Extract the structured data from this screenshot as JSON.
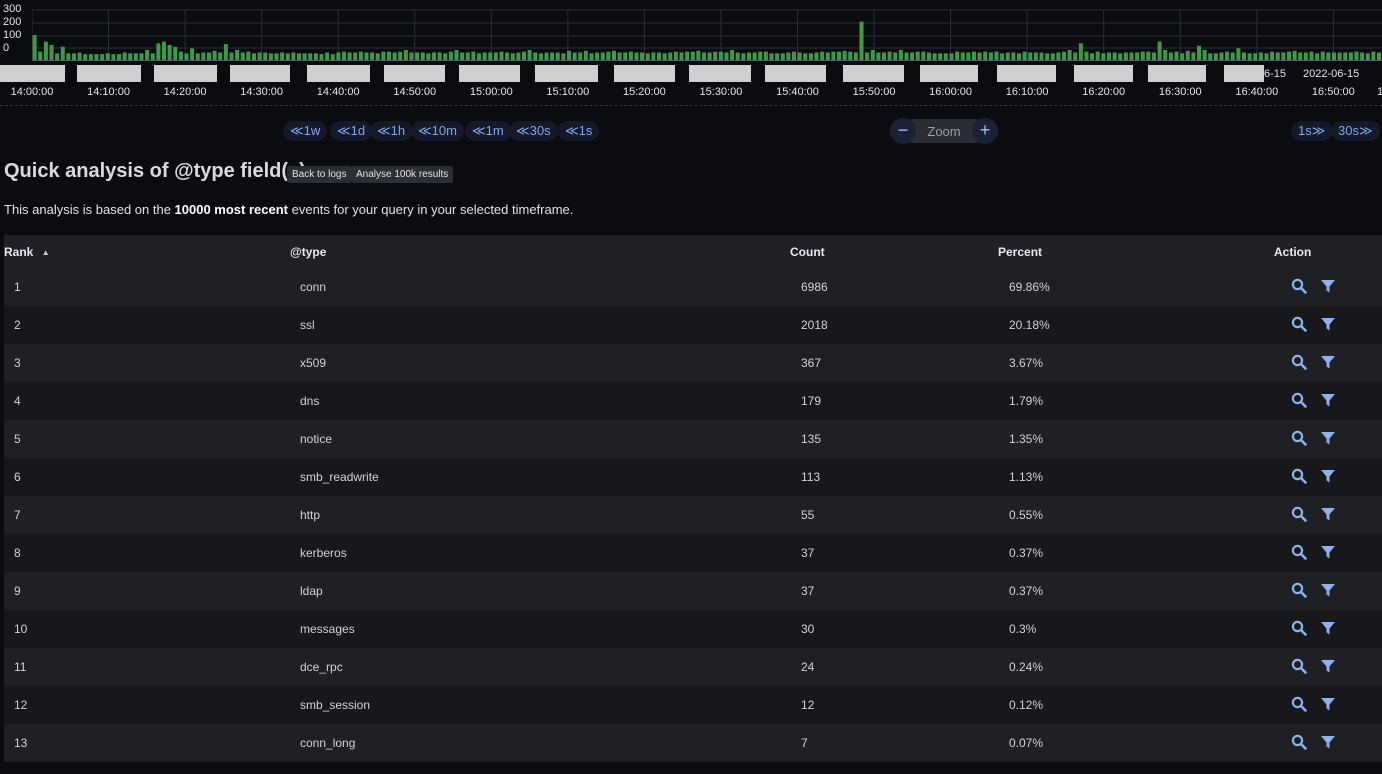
{
  "histogram": {
    "y_ticks": [
      "300",
      "200",
      "100",
      "0"
    ],
    "y_max": 300,
    "bar_values": [
      150,
      50,
      110,
      90,
      40,
      80,
      40,
      40,
      45,
      35,
      35,
      35,
      35,
      40,
      35,
      35,
      45,
      40,
      40,
      40,
      60,
      40,
      100,
      110,
      90,
      80,
      50,
      40,
      70,
      40,
      45,
      45,
      55,
      45,
      95,
      45,
      60,
      45,
      50,
      40,
      45,
      45,
      40,
      40,
      45,
      40,
      45,
      40,
      40,
      40,
      40,
      35,
      45,
      35,
      45,
      50,
      45,
      45,
      50,
      45,
      45,
      40,
      50,
      50,
      45,
      50,
      60,
      45,
      45,
      45,
      40,
      45,
      45,
      40,
      50,
      60,
      45,
      45,
      50,
      40,
      45,
      45,
      45,
      50,
      45,
      40,
      45,
      50,
      60,
      45,
      40,
      45,
      45,
      45,
      40,
      55,
      45,
      45,
      55,
      40,
      45,
      45,
      50,
      55,
      45,
      45,
      50,
      45,
      45,
      40,
      45,
      45,
      40,
      45,
      50,
      45,
      50,
      50,
      55,
      45,
      45,
      50,
      50,
      45,
      60,
      45,
      40,
      45,
      45,
      50,
      50,
      40,
      40,
      40,
      45,
      50,
      45,
      40,
      40,
      45,
      50,
      45,
      50,
      50,
      55,
      50,
      45,
      55,
      45,
      60,
      45,
      45,
      50,
      45,
      60,
      45,
      45,
      50,
      50,
      45,
      40,
      40,
      40,
      40,
      50,
      45,
      45,
      50,
      45,
      50,
      45,
      50,
      40,
      45,
      45,
      40,
      50,
      45,
      45,
      45,
      40,
      40,
      45,
      50,
      60,
      45,
      100,
      50,
      40,
      50,
      40,
      45,
      45,
      40,
      45,
      45,
      45,
      50,
      50,
      45,
      110,
      60,
      45,
      50,
      40,
      55,
      45,
      85,
      60,
      40,
      40,
      45,
      50,
      45,
      70,
      45,
      40,
      40,
      45,
      40,
      50,
      45,
      45,
      50,
      55,
      45,
      45,
      50,
      40,
      50,
      45,
      45,
      45,
      45,
      45,
      50,
      45,
      40,
      50,
      45,
      40,
      45,
      60,
      40,
      45,
      45,
      55,
      45,
      40,
      55,
      45,
      45,
      40,
      45,
      40,
      45,
      45,
      60,
      45,
      40,
      50,
      45,
      45,
      40,
      50,
      45,
      45,
      40,
      40,
      45,
      45,
      40,
      45,
      110,
      60,
      50,
      40,
      55,
      45,
      40,
      55,
      45,
      45,
      40,
      45,
      40,
      45,
      45,
      60,
      45,
      40,
      50,
      45,
      45,
      40,
      50,
      45,
      45,
      40,
      40,
      45,
      45,
      40,
      45,
      45,
      45,
      40,
      45,
      40,
      50,
      45,
      45,
      50,
      55,
      45,
      45,
      50,
      40,
      50,
      45,
      45,
      45,
      45,
      45,
      50,
      45,
      40,
      50,
      45,
      40,
      45,
      60,
      45,
      50,
      45,
      40,
      45,
      45,
      40,
      45
    ],
    "spike_value": 230,
    "date_label": "2022-06-15",
    "date_label_partial": "6-15",
    "x_ticks": [
      "14:00:00",
      "14:10:00",
      "14:20:00",
      "14:30:00",
      "14:40:00",
      "14:50:00",
      "15:00:00",
      "15:10:00",
      "15:20:00",
      "15:30:00",
      "15:40:00",
      "15:50:00",
      "16:00:00",
      "16:10:00",
      "16:20:00",
      "16:30:00",
      "16:40:00",
      "16:50:00"
    ],
    "bar_color": "#3d9a47"
  },
  "nav": {
    "back_buttons": [
      "≪1w",
      "≪1d",
      "≪1h",
      "≪10m",
      "≪1m",
      "≪30s",
      "≪1s"
    ],
    "zoom_label": "Zoom",
    "zoom_out": "−",
    "zoom_in": "+",
    "forward_buttons": [
      "1s≫",
      "30s≫"
    ]
  },
  "header": {
    "title": "Quick analysis of @type field(s)",
    "back_to_logs": "Back to logs",
    "analyse_100k": "Analyse 100k results"
  },
  "description": {
    "prefix": "This analysis is based on the ",
    "bold": "10000 most recent",
    "suffix": " events for your query in your selected timeframe."
  },
  "table": {
    "columns": {
      "rank": "Rank",
      "type": "@type",
      "count": "Count",
      "percent": "Percent",
      "action": "Action"
    },
    "sort_indicator": "▲",
    "rows": [
      {
        "rank": "1",
        "type": "conn",
        "count": "6986",
        "percent": "69.86%"
      },
      {
        "rank": "2",
        "type": "ssl",
        "count": "2018",
        "percent": "20.18%"
      },
      {
        "rank": "3",
        "type": "x509",
        "count": "367",
        "percent": "3.67%"
      },
      {
        "rank": "4",
        "type": "dns",
        "count": "179",
        "percent": "1.79%"
      },
      {
        "rank": "5",
        "type": "notice",
        "count": "135",
        "percent": "1.35%"
      },
      {
        "rank": "6",
        "type": "smb_readwrite",
        "count": "113",
        "percent": "1.13%"
      },
      {
        "rank": "7",
        "type": "http",
        "count": "55",
        "percent": "0.55%"
      },
      {
        "rank": "8",
        "type": "kerberos",
        "count": "37",
        "percent": "0.37%"
      },
      {
        "rank": "9",
        "type": "ldap",
        "count": "37",
        "percent": "0.37%"
      },
      {
        "rank": "10",
        "type": "messages",
        "count": "30",
        "percent": "0.3%"
      },
      {
        "rank": "11",
        "type": "dce_rpc",
        "count": "24",
        "percent": "0.24%"
      },
      {
        "rank": "12",
        "type": "smb_session",
        "count": "12",
        "percent": "0.12%"
      },
      {
        "rank": "13",
        "type": "conn_long",
        "count": "7",
        "percent": "0.07%"
      }
    ],
    "action_icons": [
      "search-icon",
      "filter-icon"
    ],
    "icon_color": "#8fb1e8"
  }
}
